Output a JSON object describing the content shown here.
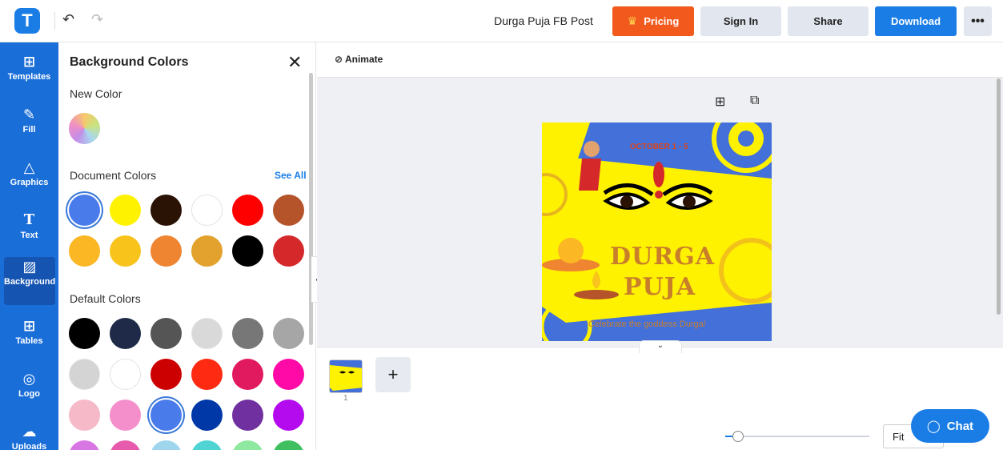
{
  "app": {
    "logo_letter": "T"
  },
  "toolbar": {
    "undo_icon": "↶",
    "redo_icon": "↷",
    "doc_title": "Durga Puja FB Post",
    "pricing_label": "Pricing",
    "signin_label": "Sign In",
    "share_label": "Share",
    "download_label": "Download",
    "more_label": "•••"
  },
  "rail": {
    "items": [
      {
        "label": "Templates",
        "icon": "⊞"
      },
      {
        "label": "Fill",
        "icon": "✎"
      },
      {
        "label": "Graphics",
        "icon": "△"
      },
      {
        "label": "Text",
        "icon": "T"
      },
      {
        "label": "Background",
        "icon": "▨"
      },
      {
        "label": "Tables",
        "icon": "⊞"
      },
      {
        "label": "Logo",
        "icon": "◎"
      },
      {
        "label": "Uploads",
        "icon": "☁"
      }
    ],
    "active": "Background"
  },
  "panel": {
    "title": "Background Colors",
    "close_icon": "✕",
    "new_color_label": "New Color",
    "document_colors_label": "Document Colors",
    "see_all_label": "See All",
    "default_colors_label": "Default Colors",
    "document_colors": [
      "#4a7bea",
      "#fff200",
      "#2a1205",
      "#ffffff",
      "#ff0000",
      "#b5532a",
      "#fbb724",
      "#f8c41c",
      "#ef8431",
      "#e2a22d",
      "#000000",
      "#d4282b"
    ],
    "default_colors": [
      "#000000",
      "#1f2a48",
      "#555555",
      "#d9d9d9",
      "#777777",
      "#a6a6a6",
      "#d4d4d4",
      "#ffffff",
      "#cc0000",
      "#ff2a12",
      "#e1195f",
      "#ff0aa6",
      "#f6b9c7",
      "#f58fcb",
      "#4a7bea",
      "#0038a8",
      "#7030a0",
      "#b40aee",
      "#d877e3",
      "#e65bab",
      "#9fd6ee",
      "#4fd3d3",
      "#8fe89f",
      "#3fbf5f"
    ]
  },
  "workspace": {
    "animate_label": "Animate",
    "add_icon": "⊞",
    "copy_icon": "⧉",
    "collapse_icon": "‹",
    "expand_icon": "⌄",
    "page_number": "1",
    "add_page_icon": "+",
    "zoom_fit_label": "Fit",
    "zoom_level_fraction": 0.05,
    "chat_label": "Chat"
  },
  "canvas_design": {
    "date_text": "OCTOBER 1 - 5",
    "title_line1": "DURGA",
    "title_line2": "PUJA",
    "subtitle": "Celebrate the goddess Durga!",
    "colors": {
      "background": "#4470d9",
      "accent": "#fff200",
      "title": "#c97f2a",
      "date": "#d9441a"
    }
  }
}
